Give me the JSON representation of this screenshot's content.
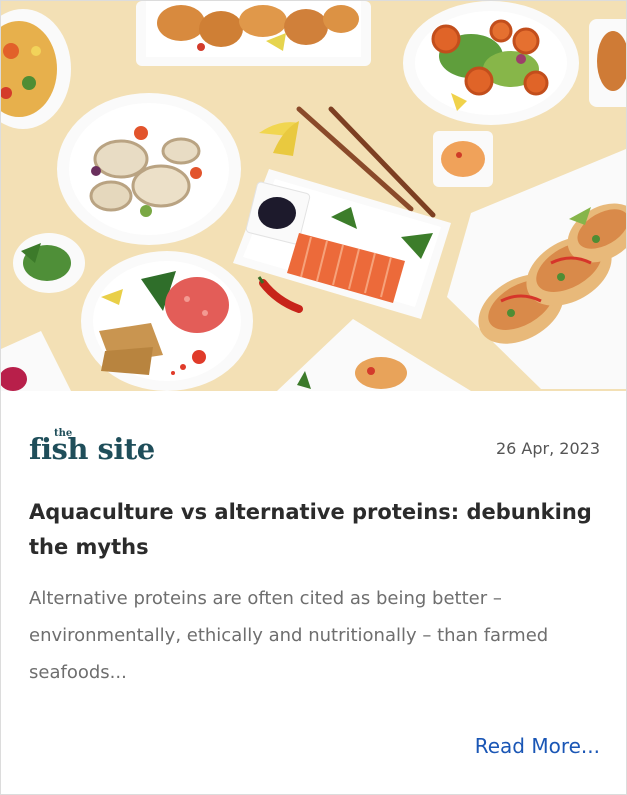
{
  "card": {
    "image": {
      "alt": "Spread of seafood dishes on white plates: fried calamari, salmon sashimi, fish tacos, tuna tartare, salads and sauces, on a pale yellow background"
    },
    "logo": {
      "the": "the",
      "main": "fish site"
    },
    "date": "26 Apr, 2023",
    "title": "Aquaculture vs alternative proteins: debunking the myths",
    "excerpt": "Alternative proteins are often cited as being better – environmentally, ethically and nutritionally – than farmed seafoods...",
    "read_more": "Read More..."
  },
  "colors": {
    "background": "#f3e0b5",
    "logo": "#1f4e5a",
    "title": "#2b2b2b",
    "excerpt": "#6e6e6e",
    "link": "#1a56b5"
  }
}
